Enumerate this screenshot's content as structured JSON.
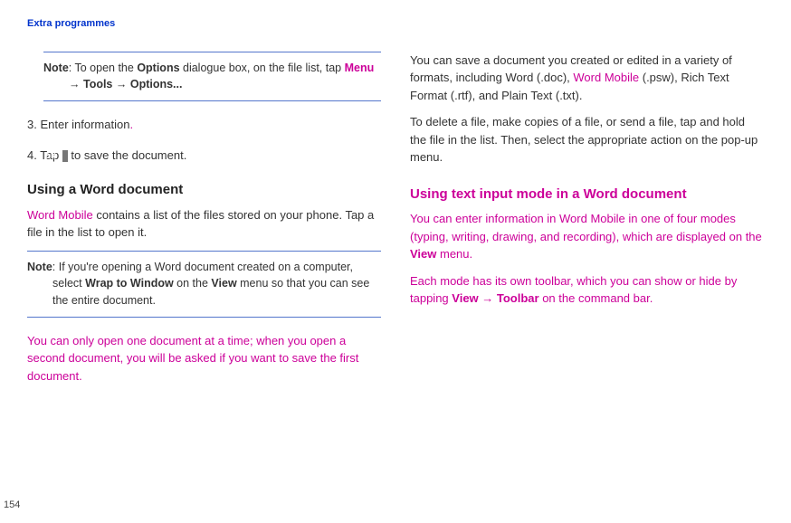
{
  "header": {
    "section_title": "Extra programmes"
  },
  "page_number": "154",
  "col1": {
    "note1_prefix": "Note",
    "note1_text_a": ": To open the ",
    "note1_b1": "Options",
    "note1_text_b": " dialogue box, on the file list, tap ",
    "note1_menu": "Menu",
    "note1_arrow1": " → ",
    "note1_tools": "Tools",
    "note1_arrow2": " → ",
    "note1_options": "Options...",
    "step3_num": "3.",
    "step3_text": " Enter information",
    "step3_dot": ".",
    "step4_num": "4.",
    "step4_text_a": " Tap ",
    "step4_ok": "ok",
    "step4_text_b": " to save the document.",
    "heading1": "Using a Word document",
    "para1_wm": "Word Mobile",
    "para1_rest": " contains a list of the files stored on your phone. Tap a file in the list to open it.",
    "note2_prefix": "Note",
    "note2_text_a": ": If you're opening a Word document created on a computer, select ",
    "note2_b1": "Wrap to Window",
    "note2_text_b": " on the ",
    "note2_b2": "View",
    "note2_text_c": " menu so that you can see the entire document.",
    "para2_pink": "You can only open one document at a time; when you open a second document, you will be asked if you want to save the first document."
  },
  "col2": {
    "para1_a": "You can save a document you created or edited in a variety of formats, including Word (.doc), ",
    "para1_wm": "Word Mobile",
    "para1_b": " (.psw), Rich Text Format (.rtf), and Plain Text (.txt).",
    "para2": "To delete a file, make copies of a file, or send a file, tap and hold the file in the list. Then, select the appropriate action on the pop-up menu.",
    "heading_pink": "Using text input mode in a Word document",
    "para3_a": "You can enter information in ",
    "para3_wm": "Word Mobile",
    "para3_b": " in one of four modes (typing, writing, drawing, and recording), which are displayed on the ",
    "para3_view": "View",
    "para3_c": " menu.",
    "para4_a": "Each mode has its own toolbar, which you can show or hide by tapping ",
    "para4_view": "View",
    "para4_arrow": " → ",
    "para4_toolbar": "Toolbar",
    "para4_b": " on the command bar."
  }
}
